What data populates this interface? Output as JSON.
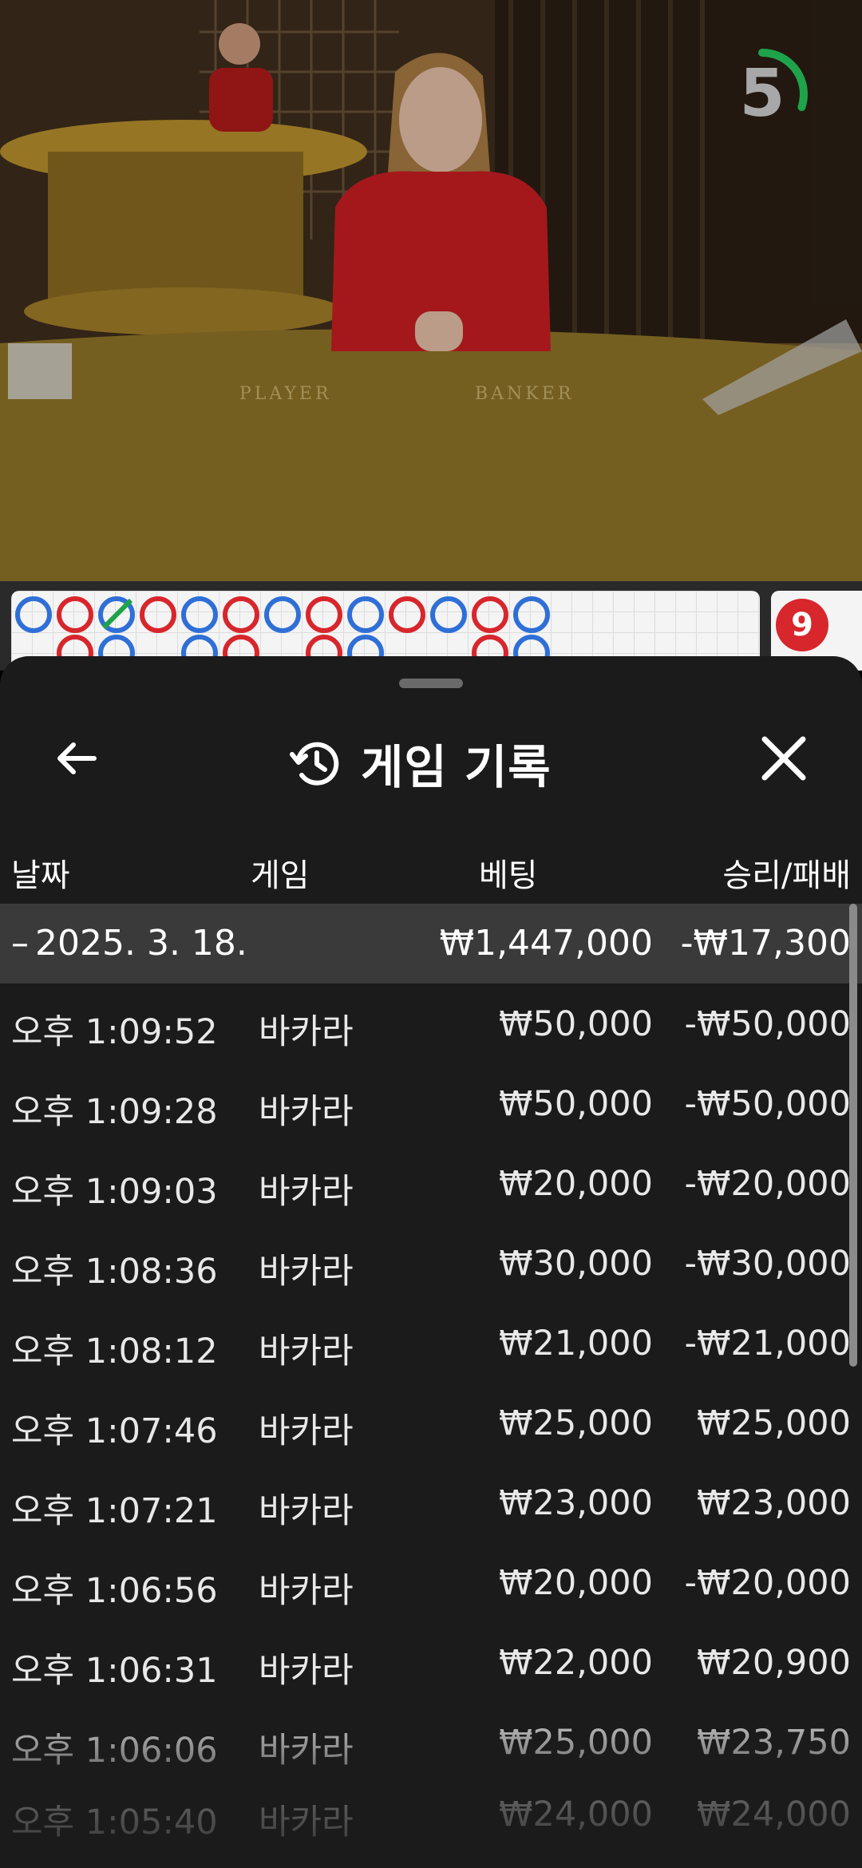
{
  "timer": {
    "value": "5",
    "progress": 0.3,
    "color": "#1fa34a"
  },
  "table_labels": {
    "player": "PLAYER",
    "banker": "BANKER"
  },
  "roadmap": {
    "side_ball_value": "9"
  },
  "history": {
    "title": "게임 기록",
    "icons": {
      "back": "arrow-left-icon",
      "history": "history-clock-icon",
      "close": "close-icon"
    },
    "columns": {
      "date": "날짜",
      "game": "게임",
      "bet": "베팅",
      "result": "승리/패배"
    },
    "date_group": {
      "expand_marker": "–",
      "date": "2025. 3. 18.",
      "total_bet": "₩1,447,000",
      "total_result": "-₩17,300"
    },
    "rows": [
      {
        "time": "오후 1:09:52",
        "game": "바카라",
        "bet": "₩50,000",
        "result": "-₩50,000"
      },
      {
        "time": "오후 1:09:28",
        "game": "바카라",
        "bet": "₩50,000",
        "result": "-₩50,000"
      },
      {
        "time": "오후 1:09:03",
        "game": "바카라",
        "bet": "₩20,000",
        "result": "-₩20,000"
      },
      {
        "time": "오후 1:08:36",
        "game": "바카라",
        "bet": "₩30,000",
        "result": "-₩30,000"
      },
      {
        "time": "오후 1:08:12",
        "game": "바카라",
        "bet": "₩21,000",
        "result": "-₩21,000"
      },
      {
        "time": "오후 1:07:46",
        "game": "바카라",
        "bet": "₩25,000",
        "result": "₩25,000"
      },
      {
        "time": "오후 1:07:21",
        "game": "바카라",
        "bet": "₩23,000",
        "result": "₩23,000"
      },
      {
        "time": "오후 1:06:56",
        "game": "바카라",
        "bet": "₩20,000",
        "result": "-₩20,000"
      },
      {
        "time": "오후 1:06:31",
        "game": "바카라",
        "bet": "₩22,000",
        "result": "₩20,900"
      },
      {
        "time": "오후 1:06:06",
        "game": "바카라",
        "bet": "₩25,000",
        "result": "₩23,750"
      },
      {
        "time": "오후 1:05:40",
        "game": "바카라",
        "bet": "₩24,000",
        "result": "₩24,000"
      }
    ]
  }
}
